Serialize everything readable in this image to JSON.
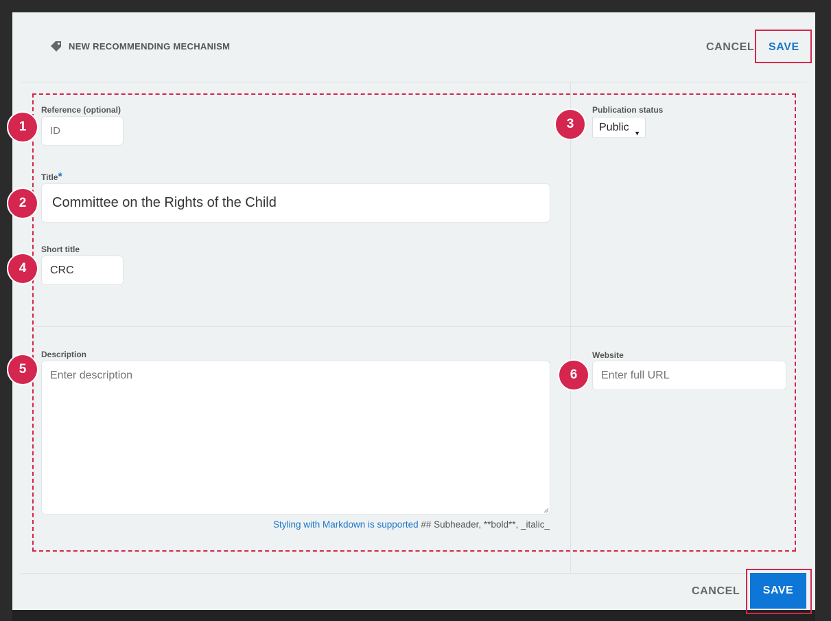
{
  "header": {
    "title": "NEW RECOMMENDING MECHANISM",
    "cancel_label": "CANCEL",
    "save_label": "SAVE"
  },
  "form": {
    "reference": {
      "label": "Reference (optional)",
      "placeholder": "ID",
      "value": ""
    },
    "title": {
      "label": "Title",
      "required_mark": "*",
      "value": "Committee on the Rights of the Child"
    },
    "short_title": {
      "label": "Short title",
      "value": "CRC"
    },
    "publication_status": {
      "label": "Publication status",
      "selected": "Public"
    },
    "description": {
      "label": "Description",
      "placeholder": "Enter description",
      "value": ""
    },
    "website": {
      "label": "Website",
      "placeholder": "Enter full URL",
      "value": ""
    },
    "markdown_link": "Styling with Markdown is supported",
    "markdown_hint": " ## Subheader, **bold**, _italic_"
  },
  "footer": {
    "cancel_label": "CANCEL",
    "save_label": "SAVE"
  },
  "badges": [
    "1",
    "2",
    "3",
    "4",
    "5",
    "6"
  ],
  "colors": {
    "accent": "#1a76c7",
    "highlight": "#d4264e",
    "primary_button": "#0d76d6",
    "modal_bg": "#eff2f3"
  },
  "icons": {
    "title_icon": "tag-icon",
    "select_arrow": "caret-down-icon"
  }
}
